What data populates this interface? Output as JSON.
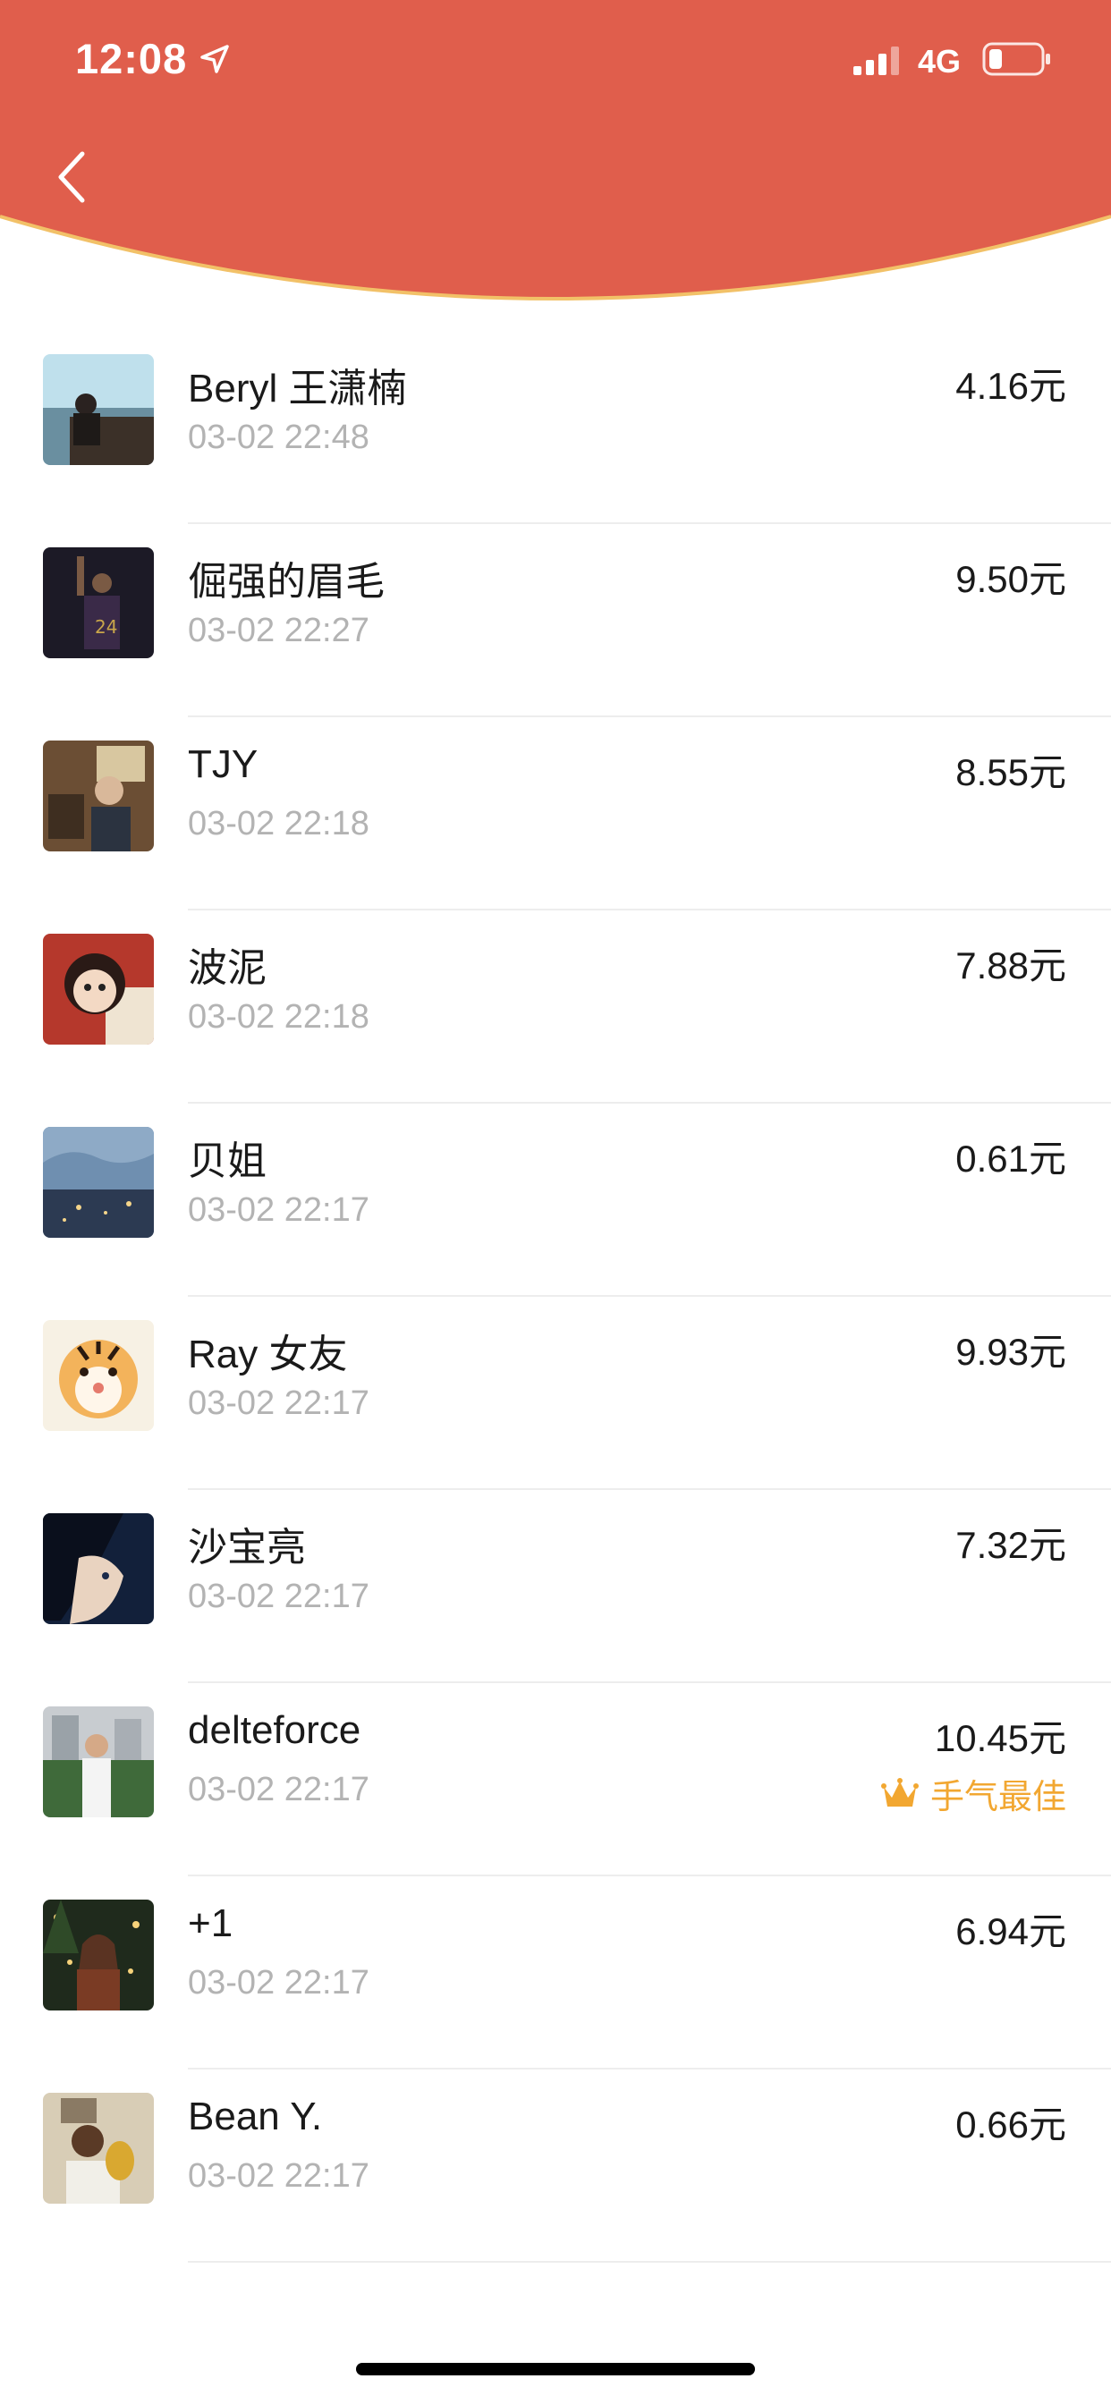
{
  "status_bar": {
    "time": "12:08",
    "network": "4G"
  },
  "colors": {
    "header_red": "#E05E4C",
    "header_edge": "#F2C168",
    "best_gold": "#F2A731"
  },
  "records": [
    {
      "name": "Beryl 王潇楠",
      "time": "03-02 22:48",
      "amount": "4.16元",
      "avatar": "lake-view-photo"
    },
    {
      "name": "倔强的眉毛",
      "time": "03-02 22:27",
      "amount": "9.50元",
      "avatar": "basketball-player-photo"
    },
    {
      "name": "TJY",
      "time": "03-02 22:18",
      "amount": "8.55元",
      "avatar": "cafe-portrait-photo"
    },
    {
      "name": "波泥",
      "time": "03-02 22:18",
      "amount": "7.88元",
      "avatar": "anime-girl-illustration"
    },
    {
      "name": "贝姐",
      "time": "03-02 22:17",
      "amount": "0.61元",
      "avatar": "night-city-photo"
    },
    {
      "name": "Ray 女友",
      "time": "03-02 22:17",
      "amount": "9.93元",
      "avatar": "cartoon-tiger-illustration"
    },
    {
      "name": "沙宝亮",
      "time": "03-02 22:17",
      "amount": "7.32元",
      "avatar": "anime-boy-illustration"
    },
    {
      "name": "delteforce",
      "time": "03-02 22:17",
      "amount": "10.45元",
      "avatar": "man-outdoor-photo",
      "best_label": "手气最佳"
    },
    {
      "name": "+1",
      "time": "03-02 22:17",
      "amount": "6.94元",
      "avatar": "christmas-tree-photo"
    },
    {
      "name": "Bean Y.",
      "time": "03-02 22:17",
      "amount": "0.66元",
      "avatar": "trophy-player-photo"
    }
  ]
}
